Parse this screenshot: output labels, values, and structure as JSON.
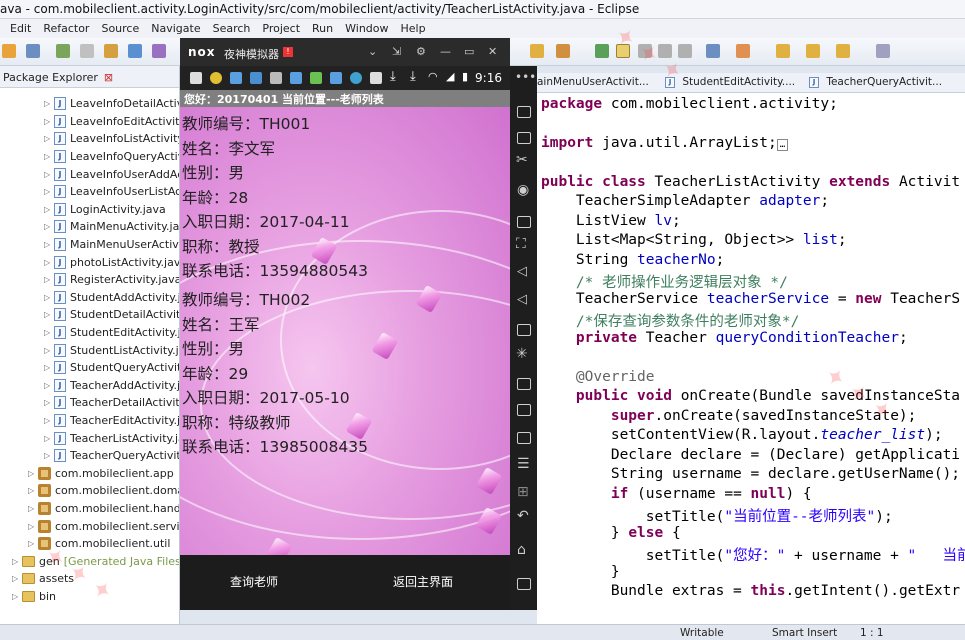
{
  "window": {
    "title": "ava - com.mobileclient.activity.LoginActivity/src/com/mobileclient/activity/TeacherListActivity.java - Eclipse"
  },
  "menu": [
    "Edit",
    "Refactor",
    "Source",
    "Navigate",
    "Search",
    "Project",
    "Run",
    "Window",
    "Help"
  ],
  "package_explorer": {
    "tab_label": "Package Explorer",
    "files": [
      "LeaveInfoDetailActivi",
      "LeaveInfoEditActivity",
      "LeaveInfoListActivity.",
      "LeaveInfoQueryActivi",
      "LeaveInfoUserAddAc",
      "LeaveInfoUserListAct",
      "LoginActivity.java",
      "MainMenuActivity.jav",
      "MainMenuUserActivi",
      "photoListActivity.java",
      "RegisterActivity.java",
      "StudentAddActivity.ja",
      "StudentDetailActivity.",
      "StudentEditActivity.ja",
      "StudentListActivity.jav",
      "StudentQueryActivity.",
      "TeacherAddActivity.ja",
      "TeacherDetailActivity.",
      "TeacherEditActivity.ja",
      "TeacherListActivity.ja",
      "TeacherQueryActivity"
    ],
    "packages": [
      "com.mobileclient.app",
      "com.mobileclient.domai",
      "com.mobileclient.handle",
      "com.mobileclient.service",
      "com.mobileclient.util"
    ],
    "gen_label": "gen",
    "gen_suffix": "[Generated Java Files]",
    "assets_label": "assets",
    "bin_label": "bin"
  },
  "emulator": {
    "logo": "nox",
    "name": "夜神模拟器",
    "badge": "!",
    "clock": "9:16",
    "action_bar": "您好：20170401   当前位置---老师列表",
    "records": [
      {
        "teacher_no": "教师编号：TH001",
        "name": "姓名：李文军",
        "gender": "性别：男",
        "age": "年龄：28",
        "hire_date": "入职日期：2017-04-11",
        "title": "职称：教授",
        "phone": "联系电话：13594880543"
      },
      {
        "teacher_no": "教师编号：TH002",
        "name": "姓名：王军",
        "gender": "性别：男",
        "age": "年龄：29",
        "hire_date": "入职日期：2017-05-10",
        "title": "职称：特级教师",
        "phone": "联系电话：13985008435"
      }
    ],
    "query_button": "查询老师",
    "back_button": "返回主界面"
  },
  "editor": {
    "tabs": [
      "ainMenuUserActivit...",
      "StudentEditActivity....",
      "TeacherQueryActivit..."
    ],
    "lines": {
      "l1a": "package ",
      "l1b": "com.mobileclient.activity;",
      "l2a": "import ",
      "l2b": "java.util.ArrayList;",
      "l3a": "public class ",
      "l3b": "TeacherListActivity ",
      "l3c": "extends ",
      "l3d": "Activit",
      "l4a": "TeacherSimpleAdapter ",
      "l4b": "adapter",
      "l4c": ";",
      "l5a": "ListView ",
      "l5b": "lv",
      "l5c": ";",
      "l6a": "List<Map<String, Object>> ",
      "l6b": "list",
      "l6c": ";",
      "l7a": "String ",
      "l7b": "teacherNo",
      "l7c": ";",
      "l8": "/* 老师操作业务逻辑层对象 */",
      "l9a": "TeacherService ",
      "l9b": "teacherService",
      "l9c": " = ",
      "l9d": "new ",
      "l9e": "TeacherS",
      "l10": "/*保存查询参数条件的老师对象*/",
      "l11a": "private ",
      "l11b": "Teacher ",
      "l11c": "queryConditionTeacher",
      "l11d": ";",
      "l12": "@Override",
      "l13a": "public void ",
      "l13b": "onCreate(Bundle savedInstanceSta",
      "l14a": "super",
      "l14b": ".onCreate(savedInstanceState);",
      "l15a": "setContentView(R.layout.",
      "l15b": "teacher_list",
      "l15c": ");",
      "l16": "Declare declare = (Declare) getApplicati",
      "l17": "String username = declare.getUserName();",
      "l18a": "if ",
      "l18b": "(username == ",
      "l18c": "null",
      "l18d": ") {",
      "l19a": "setTitle(",
      "l19b": "\"当前位置--老师列表\"",
      "l19c": ");",
      "l20a": "} ",
      "l20b": "else ",
      "l20c": "{",
      "l21a": "setTitle(",
      "l21b": "\"您好：\"",
      "l21c": " + username + ",
      "l21d": "\"   当前",
      "l22": "}",
      "l23a": "Bundle extras = ",
      "l23b": "this",
      "l23c": ".getIntent().getExtr"
    }
  },
  "status_bar": {
    "writable": "Writable",
    "insert_mode": "Smart Insert",
    "position": "1 : 1"
  }
}
